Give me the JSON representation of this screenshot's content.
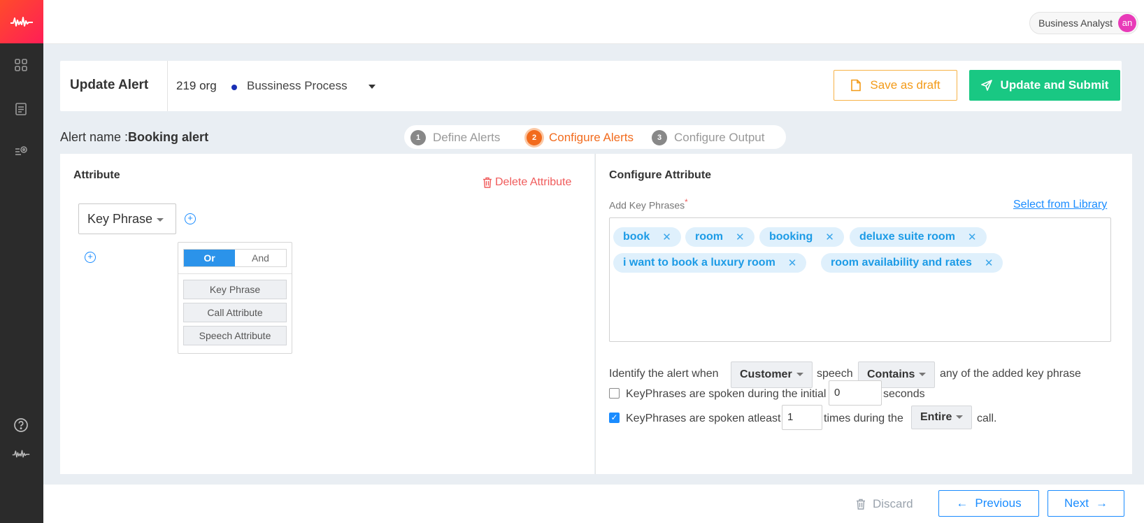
{
  "user": {
    "role": "Business Analyst",
    "initials": "an"
  },
  "header": {
    "title": "Update Alert",
    "org": "219 org",
    "process": "Bussiness Process",
    "save_draft": "Save as draft",
    "update_submit": "Update and Submit"
  },
  "alert": {
    "name_label": "Alert name :",
    "name_value": "Booking alert"
  },
  "steps": [
    {
      "num": "1",
      "label": "Define Alerts",
      "state": "done"
    },
    {
      "num": "2",
      "label": "Configure Alerts",
      "state": "active"
    },
    {
      "num": "3",
      "label": "Configure Output",
      "state": "todo"
    }
  ],
  "attribute": {
    "title": "Attribute",
    "delete_label": "Delete Attribute",
    "type_value": "Key Phrase",
    "op_or": "Or",
    "op_and": "And",
    "options": [
      "Key Phrase",
      "Call Attribute",
      "Speech Attribute"
    ]
  },
  "configure": {
    "title": "Configure Attribute",
    "add_label": "Add Key Phrases",
    "required_mark": "*",
    "library_link": "Select from Library",
    "phrases": [
      "book",
      "room",
      "booking",
      "deluxe suite room",
      "i want to book a luxury room",
      "room availability and rates"
    ],
    "identify_prefix": "Identify the alert when",
    "speaker": "Customer",
    "speech_word": "speech",
    "match": "Contains",
    "identify_suffix": "any of the added key phrase",
    "initial_label": "KeyPhrases are spoken during the initial",
    "initial_value": "0",
    "seconds_label": "seconds",
    "initial_checked": false,
    "atleast_label": "KeyPhrases are spoken atleast",
    "atleast_value": "1",
    "times_label": "times during the",
    "scope": "Entire",
    "call_label": "call.",
    "atleast_checked": true
  },
  "footer": {
    "discard": "Discard",
    "previous": "Previous",
    "next": "Next"
  },
  "colors": {
    "accent": "#1a8cff",
    "submit": "#19c883",
    "draft": "#f39a17",
    "step_active": "#f26b1d",
    "delete": "#f05b5b"
  }
}
